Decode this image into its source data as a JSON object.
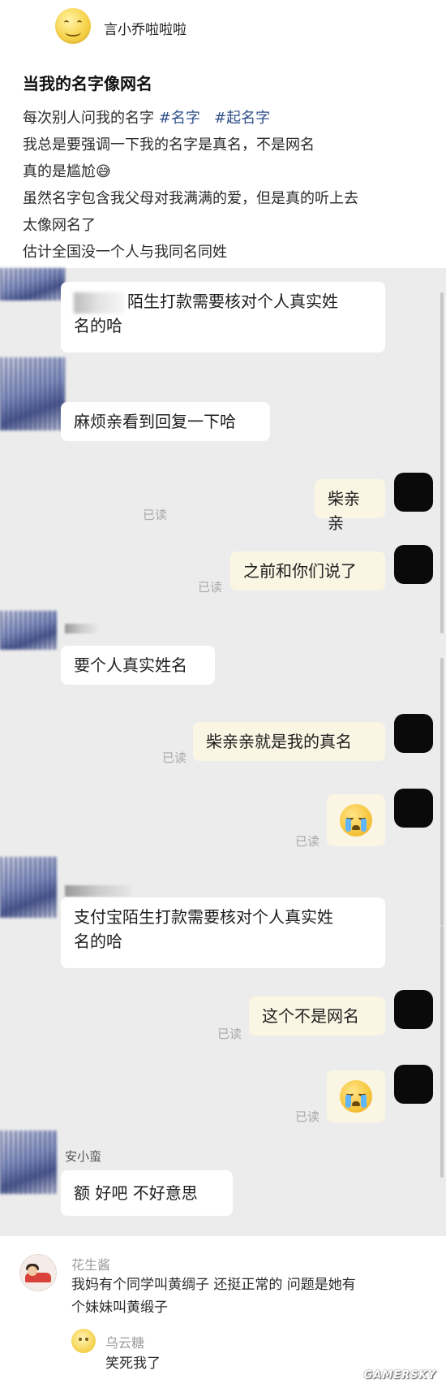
{
  "post": {
    "username": "言小乔啦啦啦",
    "title": "当我的名字像网名",
    "line1_text": "每次别人问我的名字 ",
    "tags": [
      "#名字",
      "#起名字"
    ],
    "line2": "我总是要强调一下我的名字是真名，不是网名",
    "line3": "真的是尴尬😅",
    "line4": "虽然名字包含我父母对我满满的爱，但是真的听上去",
    "line5": "太像网名了",
    "line6": "估计全国没一个人与我同名同姓"
  },
  "chat": {
    "read_label": "已读",
    "msg1_line1": "陌生打款需要核对个人真实姓",
    "msg1_line2": "名的哈",
    "msg2": "麻烦亲看到回复一下哈",
    "mine1": "柴亲亲",
    "mine2": "之前和你们说了",
    "msg3": "要个人真实姓名",
    "mine3": "柴亲亲就是我的真名",
    "mine4_icon": "crying-emoji-icon",
    "msg4_line1": "支付宝陌生打款需要核对个人真实姓",
    "msg4_line2": "名的哈",
    "mine5": "这个不是网名",
    "mine6_icon": "crying-emoji-icon",
    "sender_name": "安小蛮",
    "msg5": "额 好吧  不好意思"
  },
  "comments": [
    {
      "name": "花生酱",
      "text_line1": "我妈有个同学叫黄绸子 还挺正常的 问题是她有",
      "text_line2": "个妹妹叫黄缎子"
    },
    {
      "name": "乌云糖",
      "text": "笑死我了"
    }
  ],
  "watermark": "GAMERSKY",
  "colors": {
    "tag": "#2f4f8a",
    "chat_background": "#ececec",
    "my_bubble": "#fbf6e4",
    "their_bubble": "#ffffff"
  }
}
